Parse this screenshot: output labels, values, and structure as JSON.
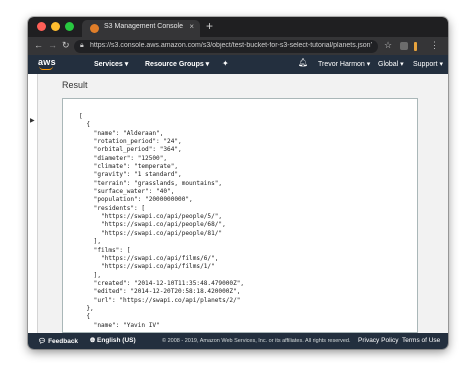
{
  "browser": {
    "tab_title": "S3 Management Console",
    "tab_close": "×",
    "new_tab": "+",
    "url": "https://s3.console.aws.amazon.com/s3/object/test-bucket-for-s3-select-tutorial/planets.json?r...",
    "icons": [
      "back-arrow-icon",
      "forward-arrow-icon",
      "reload-icon",
      "lock-icon",
      "star-icon",
      "menu-dots-icon"
    ]
  },
  "aws_nav": {
    "logo": "aws",
    "services": "Services ▾",
    "resource_groups": "Resource Groups ▾",
    "user": "Trevor Harmon ▾",
    "region": "Global ▾",
    "support": "Support ▾"
  },
  "main": {
    "result_label": "Result",
    "json_lines": [
      "[",
      "  {",
      "    \"name\": \"Alderaan\",",
      "    \"rotation_period\": \"24\",",
      "    \"orbital_period\": \"364\",",
      "    \"diameter\": \"12500\",",
      "    \"climate\": \"temperate\",",
      "    \"gravity\": \"1 standard\",",
      "    \"terrain\": \"grasslands, mountains\",",
      "    \"surface_water\": \"40\",",
      "    \"population\": \"2000000000\",",
      "    \"residents\": [",
      "      \"https://swapi.co/api/people/5/\",",
      "      \"https://swapi.co/api/people/68/\",",
      "      \"https://swapi.co/api/people/81/\"",
      "    ],",
      "    \"films\": [",
      "      \"https://swapi.co/api/films/6/\",",
      "      \"https://swapi.co/api/films/1/\"",
      "    ],",
      "    \"created\": \"2014-12-10T11:35:48.479000Z\",",
      "    \"edited\": \"2014-12-20T20:58:18.420000Z\",",
      "    \"url\": \"https://swapi.co/api/planets/2/\"",
      "  },",
      "  {",
      "    \"name\": \"Yavin IV\""
    ]
  },
  "footer": {
    "feedback": "Feedback",
    "language": "English (US)",
    "copyright": "© 2008 - 2019, Amazon Web Services, Inc. or its affiliates. All rights reserved.",
    "privacy": "Privacy Policy",
    "terms": "Terms of Use"
  },
  "colors": {
    "aws_nav_bg": "#232f3e",
    "aws_orange": "#ff9900",
    "browser_chrome": "#353537"
  }
}
